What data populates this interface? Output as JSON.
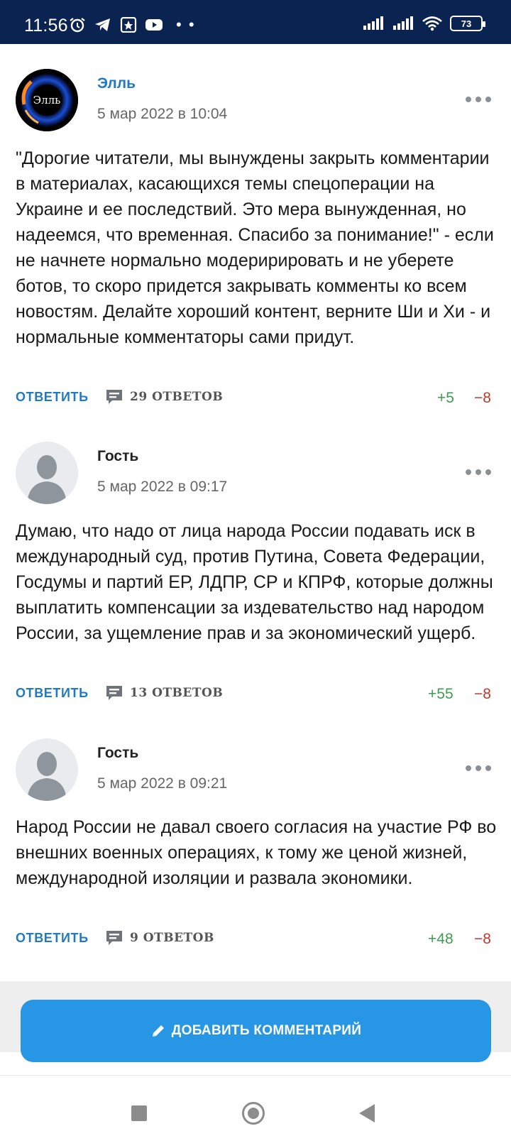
{
  "status_bar": {
    "time": "11:56",
    "battery": "73",
    "icons": [
      "alarm-icon",
      "telegram-icon",
      "app-icon",
      "youtube-icon",
      "more-dots-icon",
      "signal-icon",
      "signal-icon",
      "wifi-icon",
      "battery-icon"
    ],
    "dots": "• •"
  },
  "comments": [
    {
      "author": "Элль",
      "avatar_text": "Элль",
      "date": "5 мар 2022 в 10:04",
      "text": "\"Дорогие читатели, мы вынуждены закрыть комментарии в материалах, касающихся темы спецоперации на Украине и ее последствий. Это мера вынужденная, но надеемся, что временная. Спасибо за понимание!\" - если не начнете нормально модеририровать и не уберете ботов, то скоро придется закрывать комменты ко всем новостям. Делайте хороший контент, верните Ши и Хи - и нормальные комментаторы сами придут.",
      "reply_label": "ОТВЕТИТЬ",
      "answers_label": "29 ОТВЕТОВ",
      "votes_up": "+5",
      "votes_down": "−8"
    },
    {
      "author": "Гость",
      "date": "5 мар 2022 в 09:17",
      "text": "Думаю, что надо от лица народа России подавать иск в международный суд, против Путина, Совета Федерации, Госдумы и партий ЕР, ЛДПР, СР и КПРФ, которые должны выплатить компенсации за издевательство над народом России, за ущемление прав и за экономический ущерб.",
      "reply_label": "ОТВЕТИТЬ",
      "answers_label": "13 ОТВЕТОВ",
      "votes_up": "+55",
      "votes_down": "−8"
    },
    {
      "author": "Гость",
      "date": "5 мар 2022 в 09:21",
      "text": "Народ России не давал своего согласия на участие РФ во внешних военных операциях, к тому же ценой жизней, международной изоляции и развала экономики.",
      "reply_label": "ОТВЕТИТЬ",
      "answers_label": "9 ОТВЕТОВ",
      "votes_up": "+48",
      "votes_down": "−8"
    }
  ],
  "add_comment": {
    "label": "ДОБАВИТЬ КОММЕНТАРИЙ",
    "icon": "pencil-icon"
  },
  "colors": {
    "status_bar": "#0b2350",
    "accent": "#1f7ac1",
    "button": "#2796e5",
    "vote_up": "#3f9b4f",
    "vote_down": "#c0392b"
  }
}
